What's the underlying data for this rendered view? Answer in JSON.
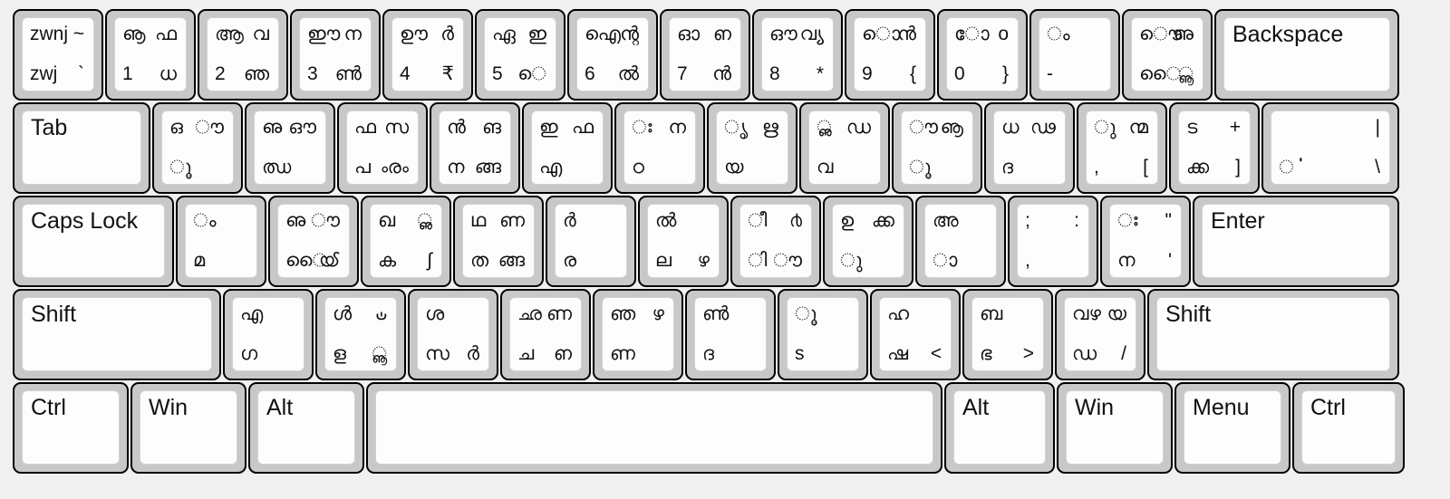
{
  "keyboard": {
    "title": "Malayalam keyboard layout",
    "colors": {
      "page_background": "#f0f0f0",
      "key_bezel": "#c8c8c8",
      "key_cap": "#fdfdfd",
      "key_outline": "#000000",
      "legend_text": "#111111"
    },
    "rows": [
      {
        "name": "number-row",
        "keys": [
          {
            "name": "key-grave",
            "width": "w-std",
            "tl": "zwnj",
            "tr": "~",
            "bl": "zwj",
            "br": "`"
          },
          {
            "name": "key-1",
            "width": "w-std",
            "tl": "ൡ",
            "tr": "ഫ",
            "bl": "1",
            "br": "ധ"
          },
          {
            "name": "key-2",
            "width": "w-std",
            "tl": "ആ",
            "tr": "വ",
            "bl": "2",
            "br": "ഞ"
          },
          {
            "name": "key-3",
            "width": "w-std",
            "tl": "ഈ",
            "tr": "ന",
            "bl": "3",
            "br": "ൺ"
          },
          {
            "name": "key-4",
            "width": "w-std",
            "tl": "ഊ",
            "tr": "ർ",
            "bl": "4",
            "br": "₹"
          },
          {
            "name": "key-5",
            "width": "w-std",
            "tl": "ഏ",
            "tr": "ഇ",
            "bl": "5",
            "br": "െ"
          },
          {
            "name": "key-6",
            "width": "w-std",
            "tl": "ഐ",
            "tr": "ന്റ",
            "bl": "6",
            "br": "ൽ"
          },
          {
            "name": "key-7",
            "width": "w-std",
            "tl": "ഓ",
            "tr": "ഩ",
            "bl": "7",
            "br": "ൻ"
          },
          {
            "name": "key-8",
            "width": "w-std",
            "tl": "ഔ",
            "tr": "വ്യ",
            "bl": "8",
            "br": "*"
          },
          {
            "name": "key-9",
            "width": "w-std",
            "tl": "ൊ",
            "tr": "ൻ",
            "bl": "9",
            "br": "{"
          },
          {
            "name": "key-0",
            "width": "w-std",
            "tl": "ോ",
            "tr": "o",
            "bl": "0",
            "br": "}"
          },
          {
            "name": "key-minus",
            "width": "w-std",
            "tl": "ം",
            "tr": "",
            "bl": "-",
            "br": ""
          },
          {
            "name": "key-equal",
            "width": "w-std",
            "tl": "ൌ",
            "tr": "ഌ",
            "bl": "ൈ",
            "br": "ൣ"
          },
          {
            "name": "key-backspace",
            "width": "w-bksp",
            "mod": "Backspace"
          }
        ]
      },
      {
        "name": "tab-row",
        "keys": [
          {
            "name": "key-tab",
            "width": "w-tab",
            "mod": "Tab"
          },
          {
            "name": "key-q",
            "width": "w-std",
            "tl": "ഒ",
            "tr": "ൗ",
            "bl": "ൂ",
            "br": ""
          },
          {
            "name": "key-w",
            "width": "w-std",
            "tl": "ഌ",
            "tr": "ഔ",
            "bl": "ഝ",
            "br": ""
          },
          {
            "name": "key-e",
            "width": "w-std",
            "tl": "ഫ",
            "tr": "സ",
            "bl": "പ",
            "br": "ൟ"
          },
          {
            "name": "key-r",
            "width": "w-std",
            "tl": "ൻ",
            "tr": "ങ",
            "bl": "ന",
            "br": "ങ്ങ"
          },
          {
            "name": "key-t",
            "width": "w-std",
            "tl": "ഇ",
            "tr": "ഫ",
            "bl": "എ",
            "br": ""
          },
          {
            "name": "key-y",
            "width": "w-std",
            "tl": "ഃ",
            "tr": "ന",
            "bl": "ഠ",
            "br": ""
          },
          {
            "name": "key-u",
            "width": "w-std",
            "tl": "ൃ",
            "tr": "ഋ",
            "bl": "യ",
            "br": ""
          },
          {
            "name": "key-i",
            "width": "w-std",
            "tl": "ൢ",
            "tr": "ഡ",
            "bl": "വ",
            "br": ""
          },
          {
            "name": "key-o",
            "width": "w-std",
            "tl": "ൗ",
            "tr": "ൡ",
            "bl": "ൂ",
            "br": ""
          },
          {
            "name": "key-p",
            "width": "w-std",
            "tl": "ധ",
            "tr": "ഢ",
            "bl": "ദ",
            "br": ""
          },
          {
            "name": "key-lbracket",
            "width": "w-std",
            "tl": "ു",
            "tr": "ന്മ",
            "bl": ",",
            "br": "["
          },
          {
            "name": "key-rbracket",
            "width": "w-std",
            "tl": "ട",
            "tr": "+",
            "bl": "ക്ക",
            "br": "]"
          },
          {
            "name": "key-backslash",
            "width": "w-bslh",
            "tl": "",
            "tr": "|",
            "bl": "ൎ",
            "br": "\\"
          }
        ]
      },
      {
        "name": "home-row",
        "keys": [
          {
            "name": "key-capslock",
            "width": "w-caps",
            "mod": "Caps Lock"
          },
          {
            "name": "key-a",
            "width": "w-std",
            "tl": "ം",
            "tr": "",
            "bl": "മ",
            "br": ""
          },
          {
            "name": "key-s",
            "width": "w-std",
            "tl": "ഌ",
            "tr": "ൗ",
            "bl": "ൈ",
            "br": "ൕ"
          },
          {
            "name": "key-d",
            "width": "w-std",
            "tl": "ഖ",
            "tr": "ൢ",
            "bl": "ക",
            "br": "∫"
          },
          {
            "name": "key-f",
            "width": "w-std",
            "tl": "ഥ",
            "tr": "ണ",
            "bl": "ത",
            "br": "ങ്ങ"
          },
          {
            "name": "key-g",
            "width": "w-std",
            "tl": "ർ",
            "tr": "",
            "bl": "ര",
            "br": ""
          },
          {
            "name": "key-h",
            "width": "w-std",
            "tl": "ൽ",
            "tr": "",
            "bl": "ല",
            "br": "ഴ"
          },
          {
            "name": "key-j",
            "width": "w-std",
            "tl": "ീ",
            "tr": "൪",
            "bl": "ി",
            "br": "ൗ"
          },
          {
            "name": "key-k",
            "width": "w-std",
            "tl": "ഉ",
            "tr": "ക്ക",
            "bl": "ു",
            "br": ""
          },
          {
            "name": "key-l",
            "width": "w-std",
            "tl": "അ",
            "tr": "",
            "bl": "ാ",
            "br": ""
          },
          {
            "name": "key-semicolon",
            "width": "w-std",
            "tl": ";",
            "tr": ":",
            "bl": ",",
            "br": ""
          },
          {
            "name": "key-quote",
            "width": "w-std",
            "tl": "ഃ",
            "tr": "\"",
            "bl": "ന",
            "br": "'"
          },
          {
            "name": "key-enter",
            "width": "w-enter",
            "mod": "Enter"
          }
        ]
      },
      {
        "name": "shift-row",
        "keys": [
          {
            "name": "key-lshift",
            "width": "w-lsh",
            "mod": "Shift"
          },
          {
            "name": "key-z",
            "width": "w-std",
            "tl": "എ",
            "tr": "",
            "bl": "ഗ",
            "br": ""
          },
          {
            "name": "key-x",
            "width": "w-std",
            "tl": "ൾ",
            "tr": "ഄ",
            "bl": "ള",
            "br": "ൣ"
          },
          {
            "name": "key-c",
            "width": "w-std",
            "tl": "ശ",
            "tr": "",
            "bl": "സ",
            "br": "ർ"
          },
          {
            "name": "key-v",
            "width": "w-std",
            "tl": "ഛ",
            "tr": "ണ",
            "bl": "ച",
            "br": "ഩ"
          },
          {
            "name": "key-b",
            "width": "w-std",
            "tl": "ഞ",
            "tr": "ഴ",
            "bl": "ണ",
            "br": ""
          },
          {
            "name": "key-n",
            "width": "w-std",
            "tl": "ൺ",
            "tr": "",
            "bl": "ദ",
            "br": ""
          },
          {
            "name": "key-m",
            "width": "w-std",
            "tl": "ൂ",
            "tr": "",
            "bl": "s",
            "br": ""
          },
          {
            "name": "key-comma",
            "width": "w-std",
            "tl": "ഹ",
            "tr": "",
            "bl": "ഷ",
            "br": "<"
          },
          {
            "name": "key-period",
            "width": "w-std",
            "tl": "ബ",
            "tr": "",
            "bl": "ഭ",
            "br": ">"
          },
          {
            "name": "key-slash",
            "width": "w-std",
            "tl": "വഴ",
            "tr": "യ",
            "bl": "ഡ",
            "br": "/"
          },
          {
            "name": "key-rshift",
            "width": "w-rsh",
            "mod": "Shift"
          }
        ]
      },
      {
        "name": "bottom-row",
        "keys": [
          {
            "name": "key-lctrl",
            "width": "w-ctrl",
            "mod": "Ctrl"
          },
          {
            "name": "key-lwin",
            "width": "w-win",
            "mod": "Win"
          },
          {
            "name": "key-lalt",
            "width": "w-alt",
            "mod": "Alt"
          },
          {
            "name": "key-space",
            "width": "w-space",
            "mod": ""
          },
          {
            "name": "key-ralt",
            "width": "w-altr",
            "mod": "Alt"
          },
          {
            "name": "key-rwin",
            "width": "w-winr",
            "mod": "Win"
          },
          {
            "name": "key-menu",
            "width": "w-menu",
            "mod": "Menu"
          },
          {
            "name": "key-rctrl",
            "width": "w-ctrlr",
            "mod": "Ctrl"
          }
        ]
      }
    ]
  }
}
